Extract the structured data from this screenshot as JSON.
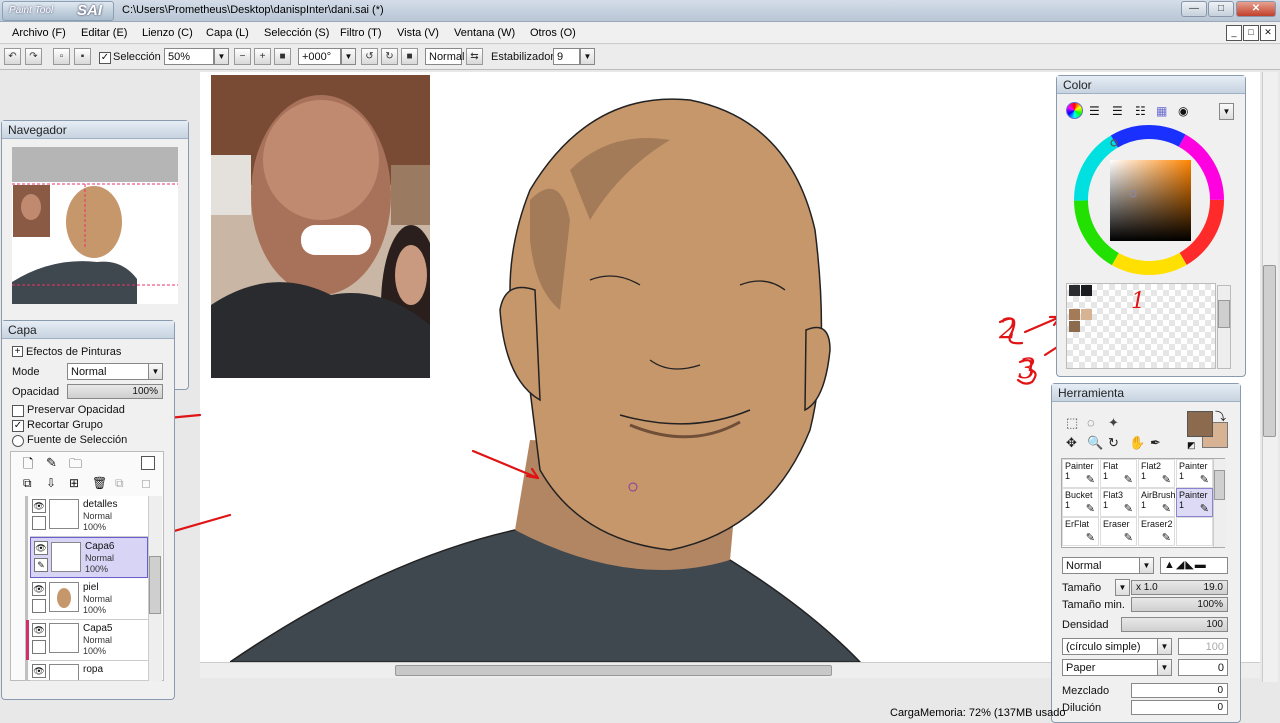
{
  "window": {
    "logo_top": "Paint Tool",
    "logo_main": "SAI",
    "path": "C:\\Users\\Prometheus\\Desktop\\danispInter\\dani.sai (*)",
    "minimize": "—",
    "maximize": "□",
    "close": "✕"
  },
  "menu": [
    "Archivo (F)",
    "Editar (E)",
    "Lienzo (C)",
    "Capa (L)",
    "Selección (S)",
    "Filtro (T)",
    "Vista (V)",
    "Ventana (W)",
    "Otros (O)"
  ],
  "toolbar": {
    "selection_label": "Selección",
    "zoom": "50%",
    "rotation": "+000°",
    "blend": "Normal",
    "stabilizer_label": "Estabilizador",
    "stabilizer_value": "9"
  },
  "navigator": {
    "title": "Navegador"
  },
  "layer_panel": {
    "title": "Capa",
    "effects": "Efectos de Pinturas",
    "mode_label": "Mode",
    "mode_value": "Normal",
    "opacity_label": "Opacidad",
    "opacity_value": "100%",
    "preserve_opacity": "Preservar Opacidad",
    "clip_group": "Recortar Grupo",
    "selection_source": "Fuente de Selección",
    "layers": [
      {
        "name": "detalles",
        "mode": "Normal",
        "opacity": "100%"
      },
      {
        "name": "Capa6",
        "mode": "Normal",
        "opacity": "100%"
      },
      {
        "name": "piel",
        "mode": "Normal",
        "opacity": "100%"
      },
      {
        "name": "Capa5",
        "mode": "Normal",
        "opacity": "100%"
      },
      {
        "name": "ropa",
        "mode": "Normal",
        "opacity": ""
      }
    ]
  },
  "color_panel": {
    "title": "Color",
    "swatches": [
      "#2a2c30",
      "#1a1b1e",
      "#a47b58",
      "#d7b293",
      "#8b6a4e"
    ]
  },
  "tool_panel": {
    "title": "Herramienta",
    "main_color": "#8b6a4e",
    "sub_color": "#d7b293",
    "tools": [
      {
        "name": "Painter",
        "size": "1"
      },
      {
        "name": "Flat",
        "size": "1"
      },
      {
        "name": "Flat2",
        "size": "1"
      },
      {
        "name": "Painter",
        "size": "1"
      },
      {
        "name": "Bucket",
        "size": "1"
      },
      {
        "name": "Flat3",
        "size": "1"
      },
      {
        "name": "AirBrush",
        "size": "1"
      },
      {
        "name": "Painter",
        "size": "1"
      },
      {
        "name": "ErFlat",
        "size": ""
      },
      {
        "name": "Eraser",
        "size": ""
      },
      {
        "name": "Eraser2",
        "size": ""
      },
      {
        "name": "",
        "size": ""
      }
    ],
    "blend": "Normal",
    "size_label": "Tamaño",
    "size_mult": "x 1.0",
    "size_value": "19.0",
    "min_size_label": "Tamaño min.",
    "min_size_value": "100%",
    "density_label": "Densidad",
    "density_value": "100",
    "shape": "(círculo simple)",
    "shape_value": "100",
    "texture": "Paper",
    "texture_value": "0",
    "blending_label": "Mezclado",
    "blending_value": "0",
    "dilution_label": "Dilución",
    "dilution_value": "0"
  },
  "annotations": {
    "one": "1",
    "two": "2",
    "three": "3"
  },
  "status": {
    "memory": "CargaMemoria: 72% (137MB usado"
  }
}
